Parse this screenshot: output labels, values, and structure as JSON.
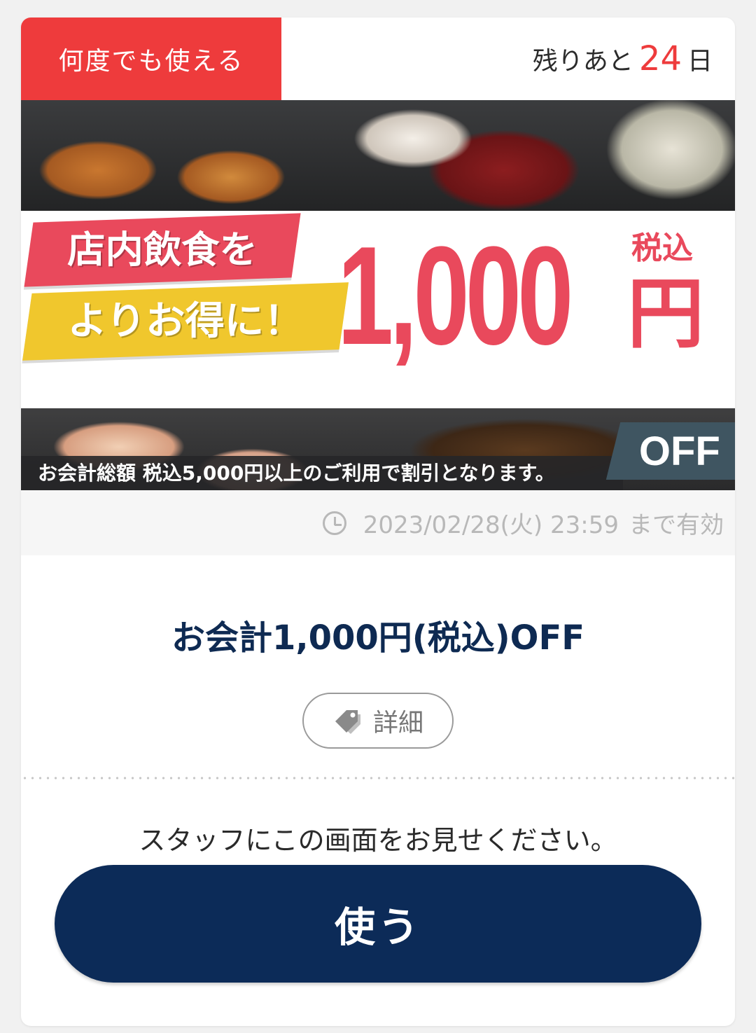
{
  "coupon": {
    "reusable_badge": "何度でも使える",
    "remaining_prefix": "残りあと",
    "remaining_days": "24",
    "remaining_suffix": "日"
  },
  "banner": {
    "headline_line1": "店内飲食を",
    "headline_line2": "よりお得に！",
    "amount": "1,000",
    "tax_label": "税込",
    "yen_label": "円",
    "off_label": "OFF",
    "note": "お会計総額 税込5,000円以上のご利用で割引となります。"
  },
  "validity": {
    "icon": "clock-icon",
    "date": "2023/02/28(火) 23:59",
    "suffix": "まで有効"
  },
  "offer": {
    "title": "お会計1,000円(税込)OFF"
  },
  "detail_button": {
    "icon": "tag-icon",
    "label": "詳細"
  },
  "instruction": "スタッフにこの画面をお見せください。",
  "use_button": {
    "label": "使う"
  },
  "colors": {
    "accent_red": "#ee3b3c",
    "navy": "#0c2b58",
    "banner_pink": "#e9495c",
    "banner_yellow": "#f0c72d"
  }
}
